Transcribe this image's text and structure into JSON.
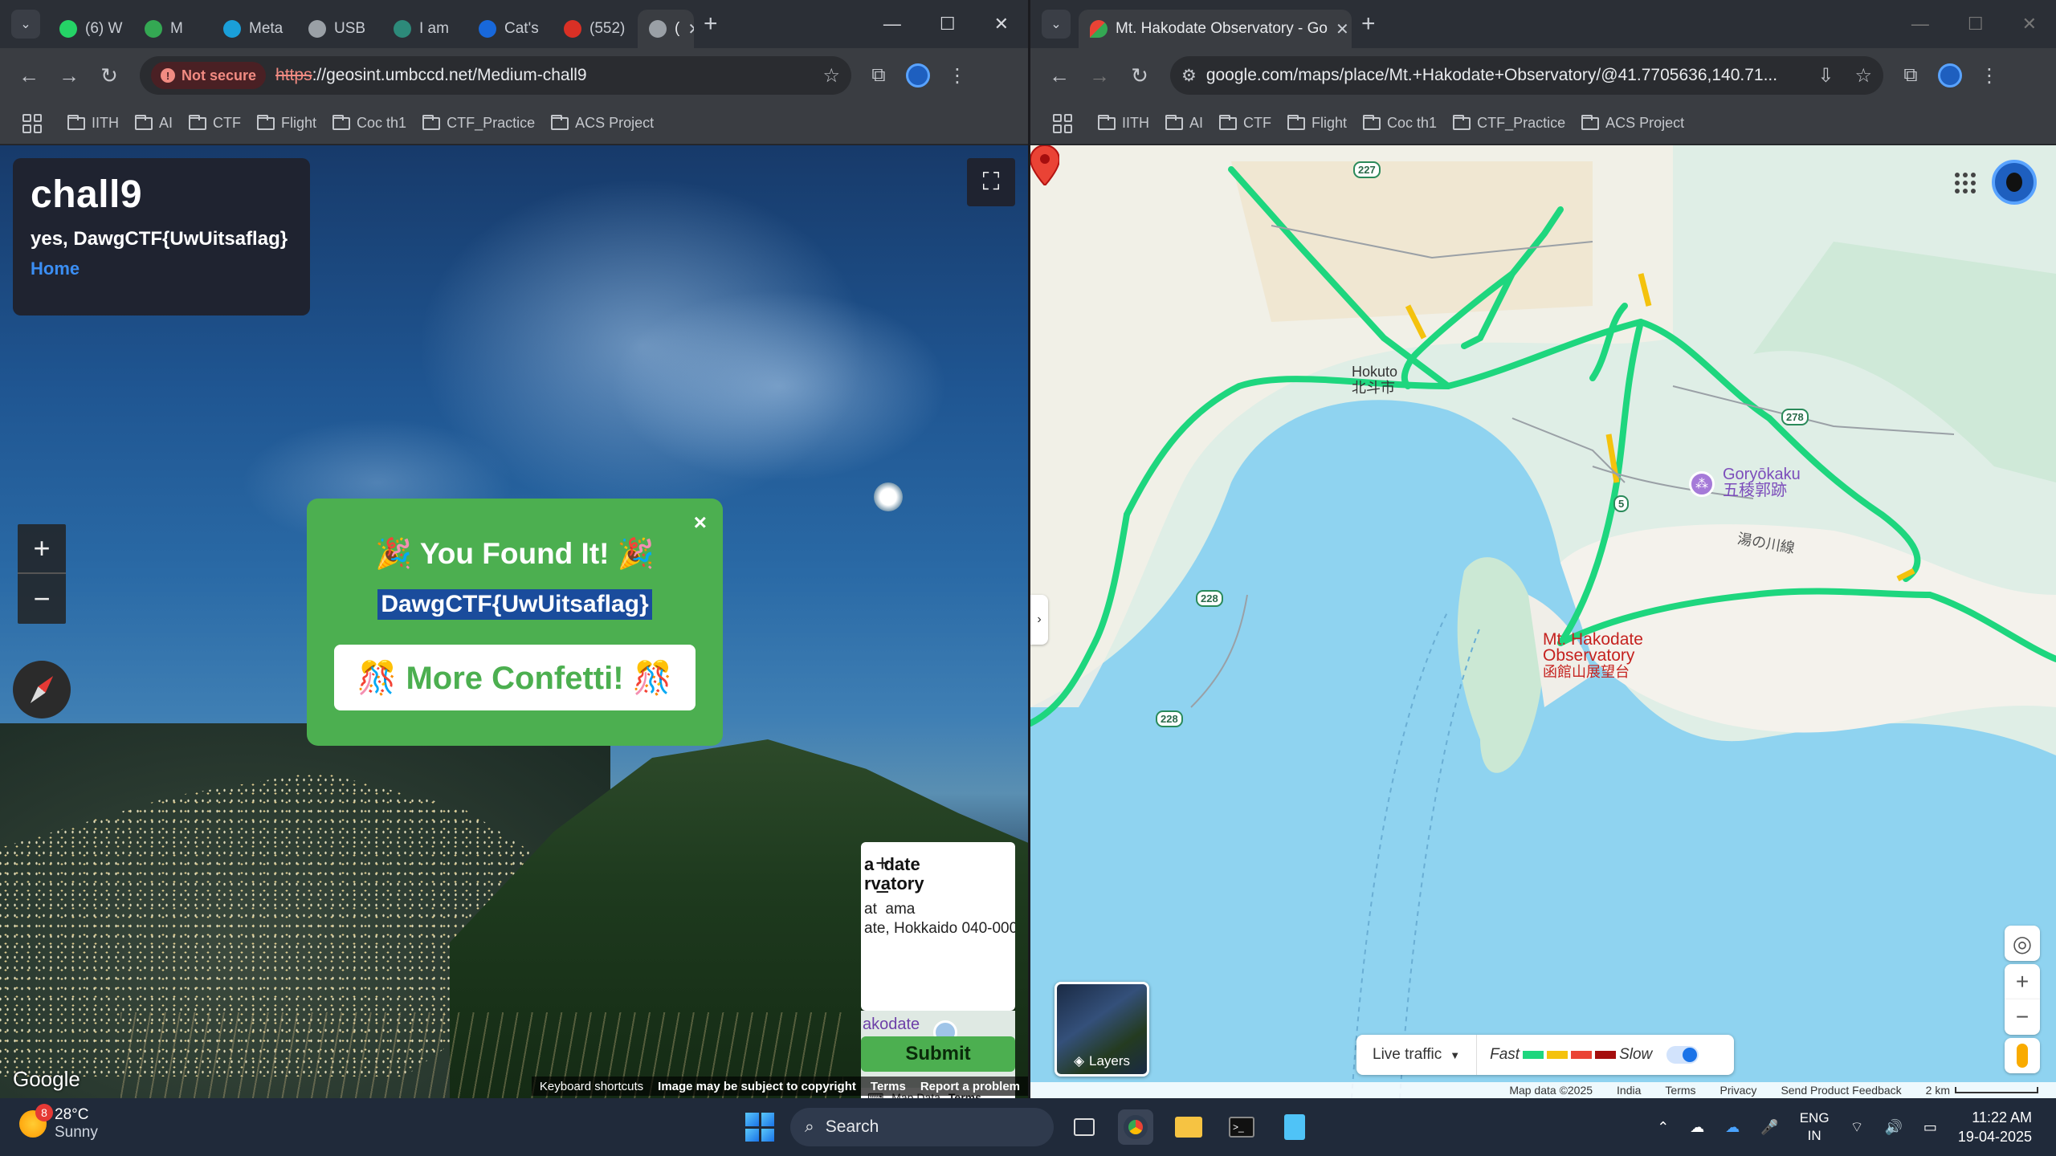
{
  "left_window": {
    "tabs": [
      {
        "label": "(6) W",
        "icon": "whatsapp-icon",
        "color": "#25d366"
      },
      {
        "label": "M",
        "icon": "meet-icon",
        "color": "#34a853"
      },
      {
        "label": "Meta",
        "icon": "meta-m-icon",
        "color": "#1a9fd9"
      },
      {
        "label": "USB",
        "icon": "web-icon",
        "color": "#9aa0a6"
      },
      {
        "label": "I am",
        "icon": "app-icon",
        "color": "#2d8a7a"
      },
      {
        "label": "Cat's",
        "icon": "confluence-icon",
        "color": "#1868db"
      },
      {
        "label": "(552)",
        "icon": "mail-icon",
        "color": "#d93025"
      },
      {
        "label": "(",
        "icon": "globe-icon",
        "color": "#9aa0a6",
        "active": true
      }
    ],
    "address": {
      "security_chip": "Not secure",
      "scheme": "https",
      "rest": "://geosint.umbccd.net/Medium-chall9"
    },
    "bookmarks": [
      "IITH",
      "AI",
      "CTF",
      "Flight",
      "Coc th1",
      "CTF_Practice",
      "ACS Project"
    ],
    "page": {
      "title": "chall9",
      "flag_line": "yes, DawgCTF{UwUitsaflag}",
      "home_link": "Home",
      "popup_title": "🎉 You Found It! 🎉",
      "popup_flag": "DawgCTF{UwUitsaflag}",
      "popup_close": "×",
      "confetti_button": "🎊 More Confetti! 🎊",
      "loc_title": "a  date\nrvatory",
      "loc_addr": "at  ama\nate, Hokkaido 040-000",
      "mini_map_label": "akodate",
      "mini_map_data": "Map Data",
      "mini_map_terms": "Terms",
      "submit": "Submit",
      "google": "Google",
      "footer": [
        "Keyboard shortcuts",
        "Image may be subject to copyright",
        "Terms",
        "Report a problem"
      ]
    }
  },
  "right_window": {
    "tab": {
      "label": "Mt. Hakodate Observatory - Go",
      "icon": "google-maps-icon"
    },
    "address": "google.com/maps/place/Mt.+Hakodate+Observatory/@41.7705636,140.71...",
    "bookmarks": [
      "IITH",
      "AI",
      "CTF",
      "Flight",
      "Coc th1",
      "CTF_Practice",
      "ACS Project"
    ],
    "map": {
      "labels": {
        "hokuto_en": "Hokuto",
        "hokuto_jp": "北斗市",
        "goryokaku_en": "Goryōkaku",
        "goryokaku_jp": "五稜郭跡",
        "yunokawa": "湯の川線",
        "place_en_1": "Mt. Hakodate",
        "place_en_2": "Observatory",
        "place_jp": "函館山展望台"
      },
      "road_shields": [
        "227",
        "278",
        "5",
        "228",
        "228"
      ],
      "layers": "Layers",
      "live_traffic": "Live traffic",
      "fast": "Fast",
      "slow": "Slow",
      "traffic_colors": [
        "#1ed67e",
        "#f4c20d",
        "#ea4335",
        "#a50e0e"
      ],
      "footer": [
        "Map data ©2025",
        "India",
        "Terms",
        "Privacy",
        "Send Product Feedback"
      ],
      "scale": "2 km"
    }
  },
  "taskbar": {
    "weather_temp": "28°C",
    "weather_desc": "Sunny",
    "weather_badge": "8",
    "search": "Search",
    "lang_1": "ENG",
    "lang_2": "IN",
    "time": "11:22 AM",
    "date": "19-04-2025"
  }
}
